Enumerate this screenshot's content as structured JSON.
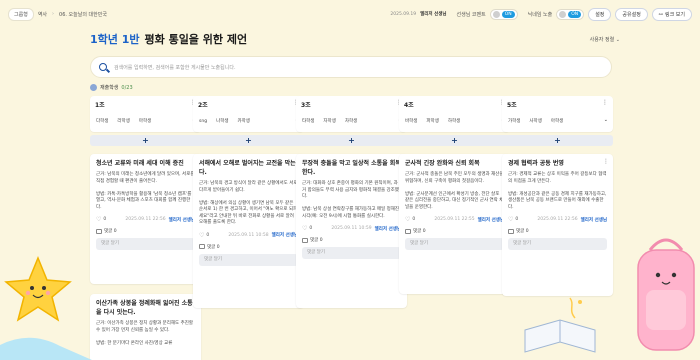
{
  "breadcrumb": [
    "그룹형",
    "역사",
    "06. 오늘날의 대한민국"
  ],
  "meta": {
    "date": "2025.09.19",
    "author": "엘리저 선생님"
  },
  "anon_comment": {
    "label": "선생님 코멘트",
    "state": "ON"
  },
  "nickname_toggle": {
    "label": "닉네임 노출",
    "state": "ON"
  },
  "buttons": {
    "settings": "설정",
    "share_settings": "공유설정",
    "link_view": "링크 보기"
  },
  "title": {
    "highlight": "1학년 1반",
    "text": "평화 통일을 위한 제언"
  },
  "sort_label": "사용자 정렬",
  "search": {
    "placeholder": "검색어를 입력하면, 검색어를 포함한 게시물만 노출됩니다."
  },
  "students": {
    "label": "재출학생",
    "count": "0/23"
  },
  "columns": [
    {
      "title": "1조",
      "tags": [
        "다학생",
        "라학생",
        "마학생"
      ]
    },
    {
      "title": "2조",
      "tags": [
        "sng",
        "나학생",
        "카학생"
      ]
    },
    {
      "title": "3조",
      "tags": [
        "타학생",
        "자학생",
        "차학생"
      ]
    },
    {
      "title": "4조",
      "tags": [
        "바학생",
        "파학생",
        "하학생"
      ]
    },
    {
      "title": "5조",
      "tags": [
        "가학생",
        "사학생",
        "아학생"
      ]
    }
  ],
  "add_symbol": "+",
  "cards": [
    {
      "title": "청소년 교류와 미래 세대 이해 증진",
      "body": "근거: 남북의 미래는 청소년에게 달려 있으며, 서로를 직접 경험할 때 편견이 줄어든다.\n\n방법: 카톡·카톡방학을 활용해 '남북 청소년 캠프'를 열고, 역사·문화 체험과 스포츠 대회를 함께 진행한다.",
      "likes": "0",
      "date": "2025.09.11 22:56",
      "author": "엘리저 선생님",
      "comments": "댓글 0",
      "comment_ph": "댓글 달기"
    },
    {
      "title": "서해에서 오해로 벌어지는 교전을 막는다.",
      "body": "근거: 남북의 경고 방식이 달라 같은 상황에서도 서로 다르게 받아들이기 쉽다.\n\n방법: 해상에서 의심 상황이 생기면 남북 모두 같은 순서로 1) 한 번 경고하고, 이어서 \"여노 확으로 되파세요\"라고 안내한 뒤 바로 전화로 상황을 서로 알려 오해를 풀도록 한다.",
      "likes": "0",
      "date": "2025.09.11 10:58",
      "author": "엘리저 선생님",
      "comments": "댓글 0",
      "comment_ph": "댓글 달기"
    },
    {
      "title": "무장적 충돌을 막고 일상적 소통을 회복한다.",
      "body": "근거: 대화와 상호 존중이 평화의 기본 원칙이며, 과거 합의들도 무력 사용 금지와 평화적 해결을 강조했다.\n\n방법: 남북 상설 연락창구를 재가동하고 매일 정해진 시각(예: 오전 9시)에 시험 통화를 실시한다.",
      "likes": "0",
      "date": "2025.09.11 10:59",
      "author": "엘리저 선생님",
      "comments": "댓글 0",
      "comment_ph": "댓글 달기"
    },
    {
      "title": "군사적 긴장 완화와 신뢰 회복",
      "body": "근거: 군사적 충돌은 남북 주민 모두의 생명과 재산을 위협하며, 신뢰 구축이 평화의 첫걸음이다.\n\n방법: 군사분계선 인근에서 확성기 방송, 전단 살포 같은 심리전을 중단하고, 대신 정기적인 군사 연락 채널을 운영한다.",
      "likes": "0",
      "date": "2025.09.11 22:55",
      "author": "엘리저 선생님",
      "comments": "댓글 0",
      "comment_ph": "댓글 달기"
    },
    {
      "title": "경제 협력과 공동 번영",
      "body": "근거: 경제적 교류는 상호 이익을 주어 갈등보다 협력의 이점을 크게 만든다.\n\n방법: 개성공단과 같은 공동 경제 지구를 재가동하고, 생산품은 남북 공동 브랜드로 만들어 해외에 수출한다.",
      "likes": "0",
      "date": "2025.09.11 22:56",
      "author": "엘리저 선생님",
      "comments": "댓글 0",
      "comment_ph": "댓글 달기"
    },
    {
      "title": "이산가족 상봉을 정례화해 잃어진 소통을 다시 잇는다.",
      "body": "근거: 이산가족 상봉은 정치 상황과 분리해도 추진할 수 있어 가장 먼저 신뢰를 높일 수 있다.\n\n방법: 한 분기마다 온라인 사진/영상 교류"
    }
  ]
}
